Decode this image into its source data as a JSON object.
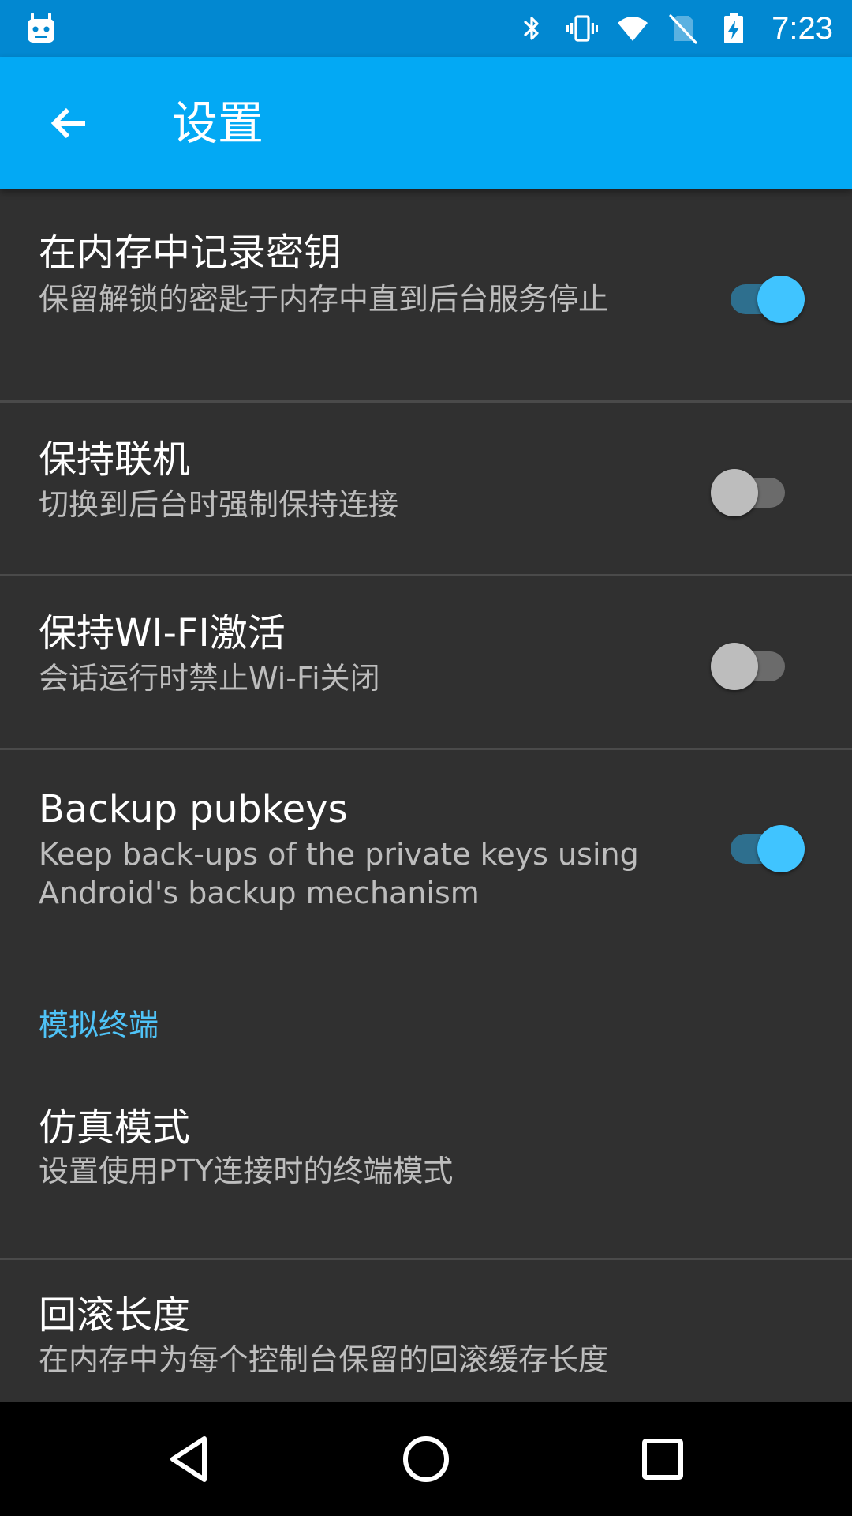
{
  "status_bar": {
    "time": "7:23",
    "icons": [
      "android-debug-icon",
      "bluetooth-icon",
      "vibrate-icon",
      "wifi-icon",
      "no-sim-icon",
      "battery-charging-icon"
    ]
  },
  "app_bar": {
    "title": "设置",
    "back_icon": "arrow-back-icon"
  },
  "preferences": [
    {
      "title": "在内存中记录密钥",
      "summary": "保留解锁的密匙于内存中直到后台服务停止",
      "switch_on": true
    },
    {
      "title": "保持联机",
      "summary": "切换到后台时强制保持连接",
      "switch_on": false
    },
    {
      "title": "保持WI-FI激活",
      "summary": "会话运行时禁止Wi-Fi关闭",
      "switch_on": false
    },
    {
      "title": "Backup pubkeys",
      "summary": "Keep back-ups of the private keys using Android's backup mechanism",
      "switch_on": true
    }
  ],
  "category": {
    "title": "模拟终端"
  },
  "terminal_preferences": [
    {
      "title": "仿真模式",
      "summary": "设置使用PTY连接时的终端模式"
    },
    {
      "title": "回滚长度",
      "summary": "在内存中为每个控制台保留的回滚缓存长度"
    }
  ],
  "nav_bar": {
    "icons": [
      "nav-back-icon",
      "nav-home-icon",
      "nav-recents-icon"
    ]
  },
  "colors": {
    "status_bar": "#0288d1",
    "app_bar": "#03a9f4",
    "background": "#303030",
    "accent": "#40c4ff",
    "category_text": "#4fc3f7"
  }
}
